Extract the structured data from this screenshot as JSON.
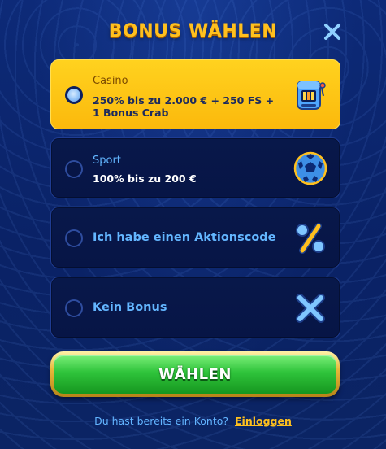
{
  "header": {
    "title": "BONUS WÄHLEN",
    "close_icon": "close-icon"
  },
  "options": [
    {
      "label": "Casino",
      "description_line1": "250% bis zu 2.000 € + 250 FS +",
      "description_line2": "1 Bonus Crab",
      "selected": true,
      "icon": "slot-machine-icon"
    },
    {
      "label": "Sport",
      "description_line1": "100% bis zu 200 €",
      "selected": false,
      "icon": "soccer-ball-icon"
    },
    {
      "label": "Ich habe einen Aktionscode",
      "selected": false,
      "icon": "percent-icon"
    },
    {
      "label": "Kein Bonus",
      "selected": false,
      "icon": "x-mark-icon"
    }
  ],
  "cta": {
    "label": "WÄHLEN"
  },
  "footer": {
    "text": "Du hast bereits ein Konto?",
    "link": "Einloggen"
  },
  "colors": {
    "background": "#0b2466",
    "accent_gold": "#ffc01e",
    "selected_card": "#fbc415",
    "card_dark": "#08184a",
    "link_blue": "#63b6ff",
    "button_green": "#2fc43b"
  }
}
